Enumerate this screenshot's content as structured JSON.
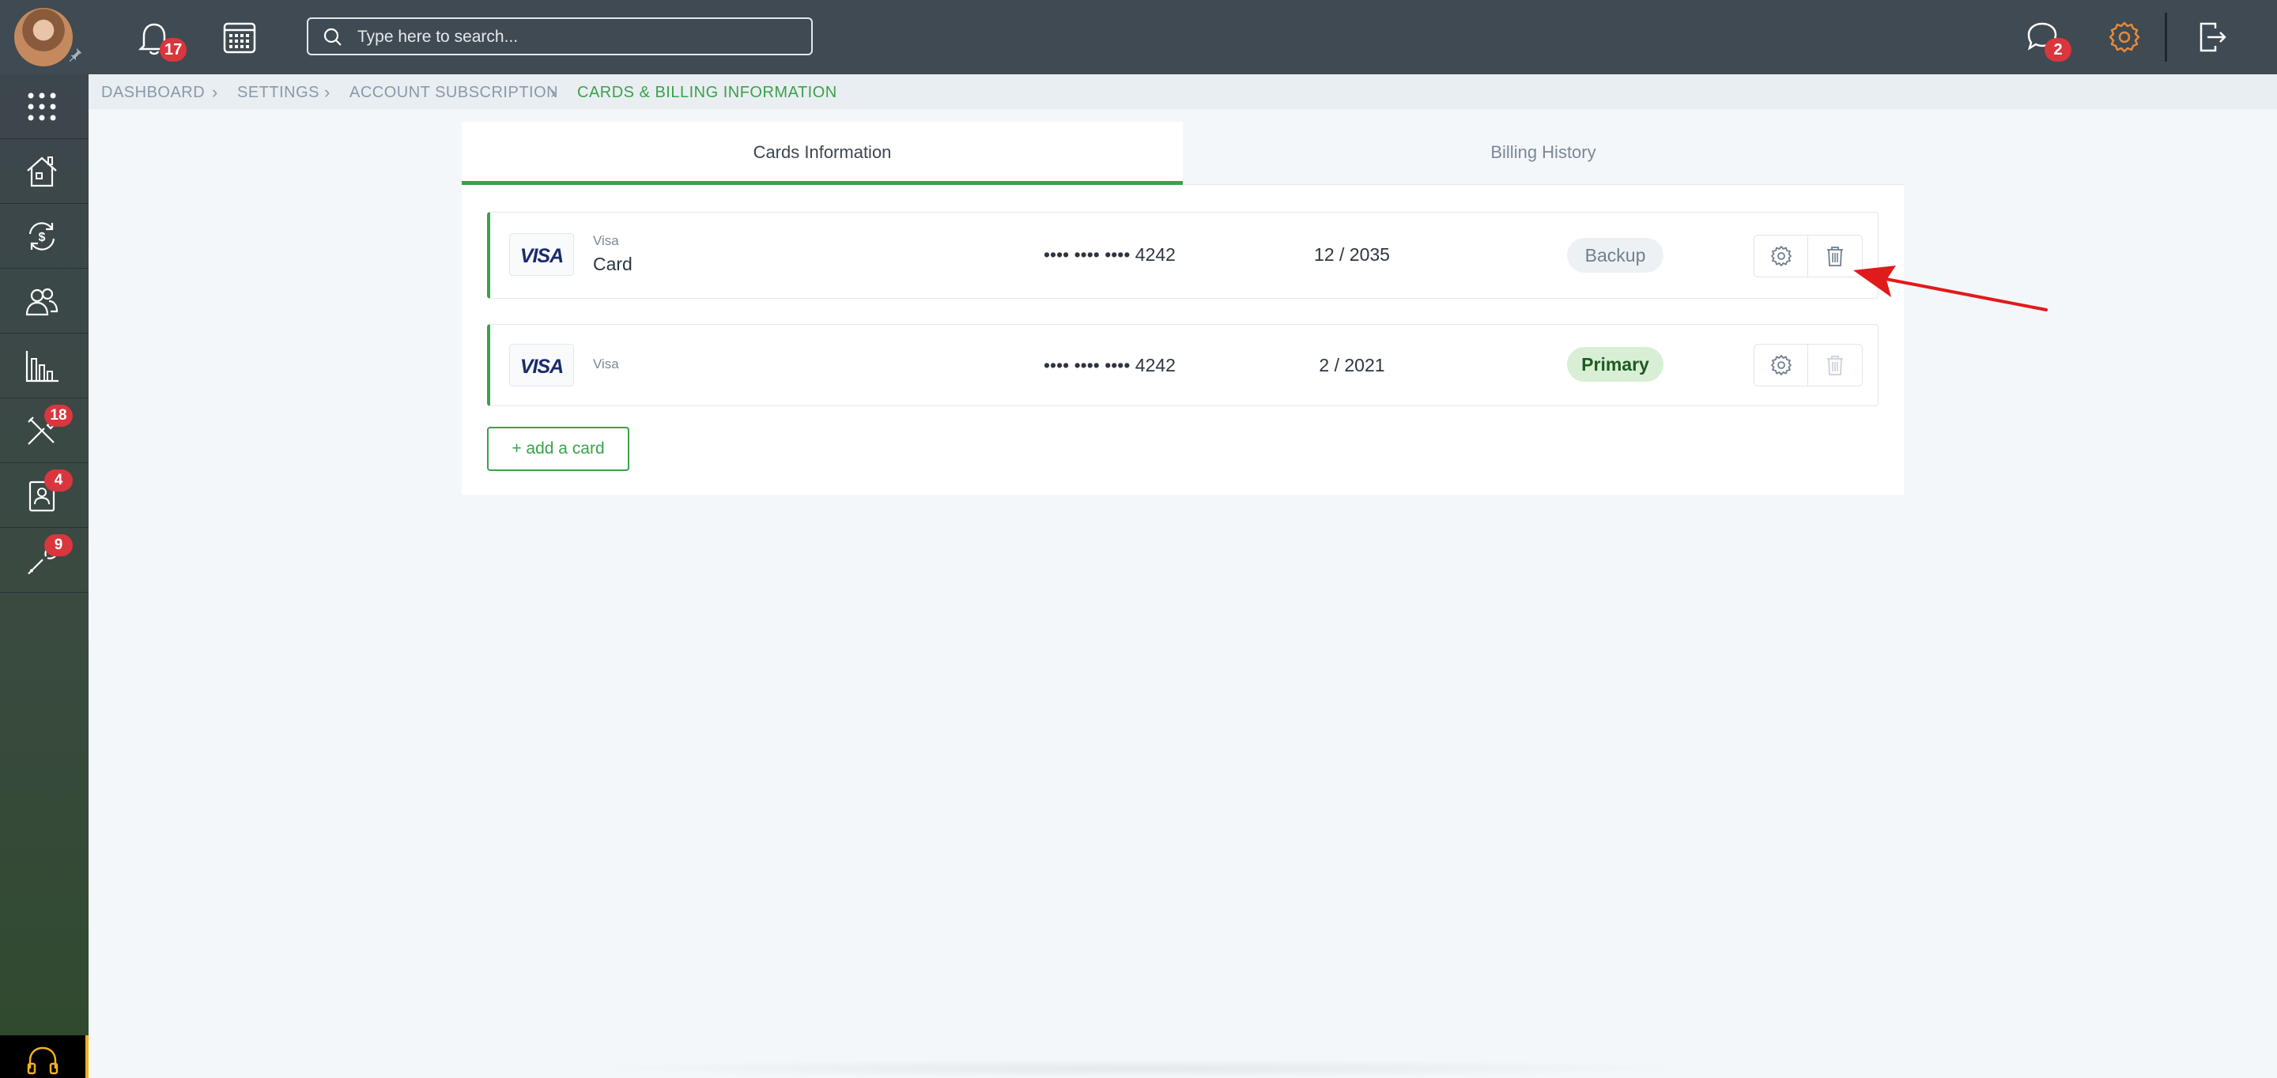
{
  "header": {
    "notifications_count": "17",
    "messages_count": "2",
    "search_placeholder": "Type here to search..."
  },
  "sidebar": {
    "items": [
      {
        "icon": "apps-grid-icon",
        "badge": ""
      },
      {
        "icon": "home-icon",
        "badge": ""
      },
      {
        "icon": "billing-cycle-icon",
        "badge": ""
      },
      {
        "icon": "users-icon",
        "badge": ""
      },
      {
        "icon": "reports-chart-icon",
        "badge": ""
      },
      {
        "icon": "tools-icon",
        "badge": "18"
      },
      {
        "icon": "contact-card-icon",
        "badge": "4"
      },
      {
        "icon": "wrench-icon",
        "badge": "9"
      }
    ]
  },
  "breadcrumb": {
    "items": [
      "DASHBOARD",
      "SETTINGS",
      "ACCOUNT SUBSCRIPTION"
    ],
    "current": "CARDS & BILLING INFORMATION"
  },
  "tabs": {
    "cards": "Cards Information",
    "billing": "Billing History",
    "active": "cards"
  },
  "cards": [
    {
      "logo": "VISA",
      "brand": "Visa",
      "name": "Card",
      "number": "•••• •••• •••• 4242",
      "expiry": "12 / 2035",
      "status": "Backup"
    },
    {
      "logo": "VISA",
      "brand": "Visa",
      "name": "",
      "number": "•••• •••• •••• 4242",
      "expiry": "2 / 2021",
      "status": "Primary"
    }
  ],
  "add_card_label": "+ add a card",
  "colors": {
    "accent_green": "#3aa14a",
    "topbar": "#3f4a52",
    "badge_red": "#d9363e",
    "settings_orange": "#e8893a",
    "annotation_red": "#e01b1b"
  }
}
